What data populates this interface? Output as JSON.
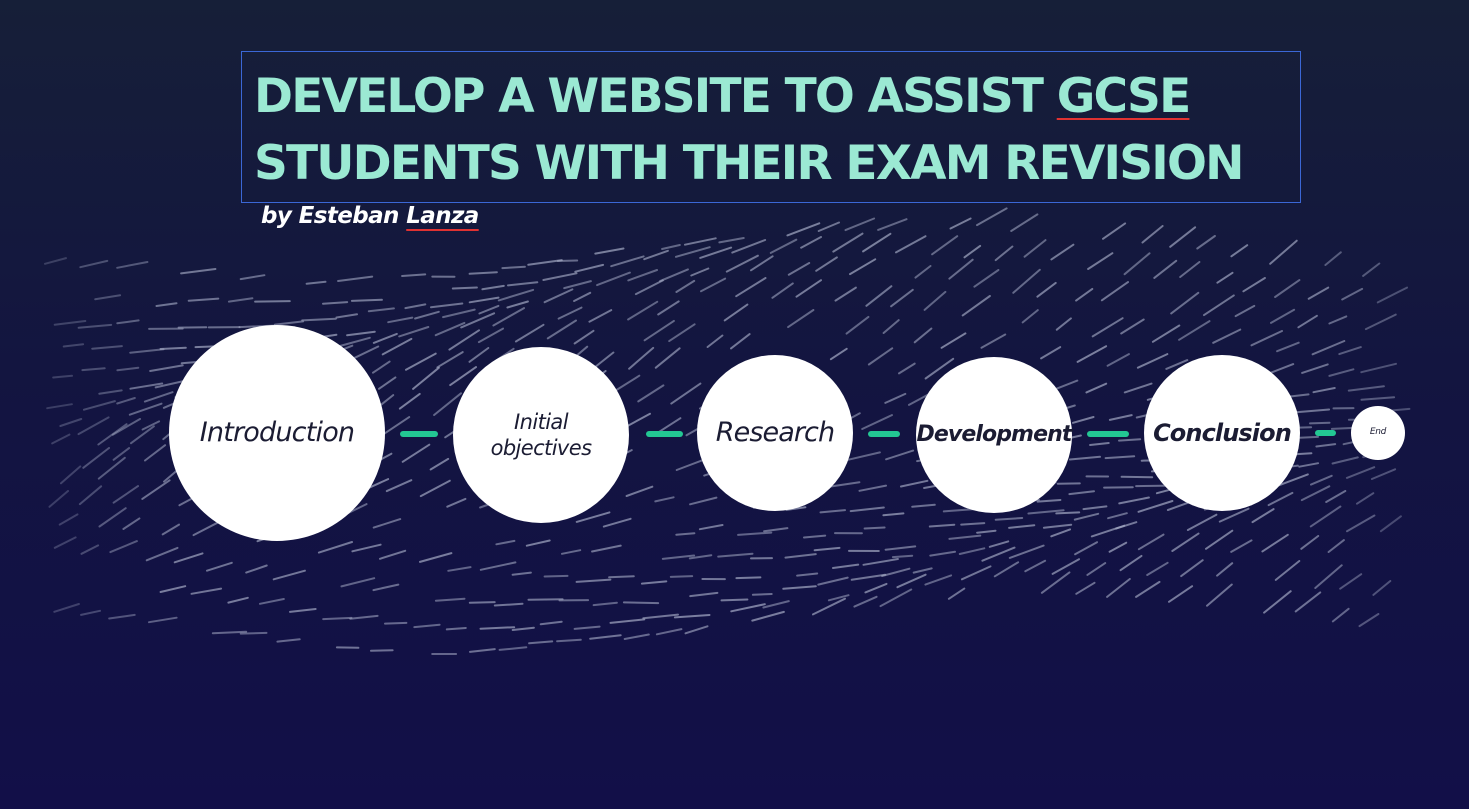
{
  "title": {
    "line1_pre": "DEVELOP A WEBSITE TO ASSIST ",
    "line1_flagged": "GCSE",
    "line2": "STUDENTS WITH THEIR EXAM REVISION"
  },
  "byline": {
    "prefix": "by Esteban ",
    "flagged": "Lanza"
  },
  "path": {
    "nodes": [
      {
        "label": "Introduction"
      },
      {
        "label": "Initial objectives"
      },
      {
        "label": "Research"
      },
      {
        "label": "Development"
      },
      {
        "label": "Conclusion"
      },
      {
        "label": "End"
      }
    ]
  },
  "colors": {
    "title": "#9be9d3",
    "connector": "#23c793",
    "frame_border": "#3b67d6",
    "spell_underline": "#e03232",
    "background_top": "#161f38",
    "background_bottom": "#120f48",
    "node_fill": "#ffffff",
    "node_text": "#1b1c33",
    "dash_texture": "#a7adc7"
  }
}
